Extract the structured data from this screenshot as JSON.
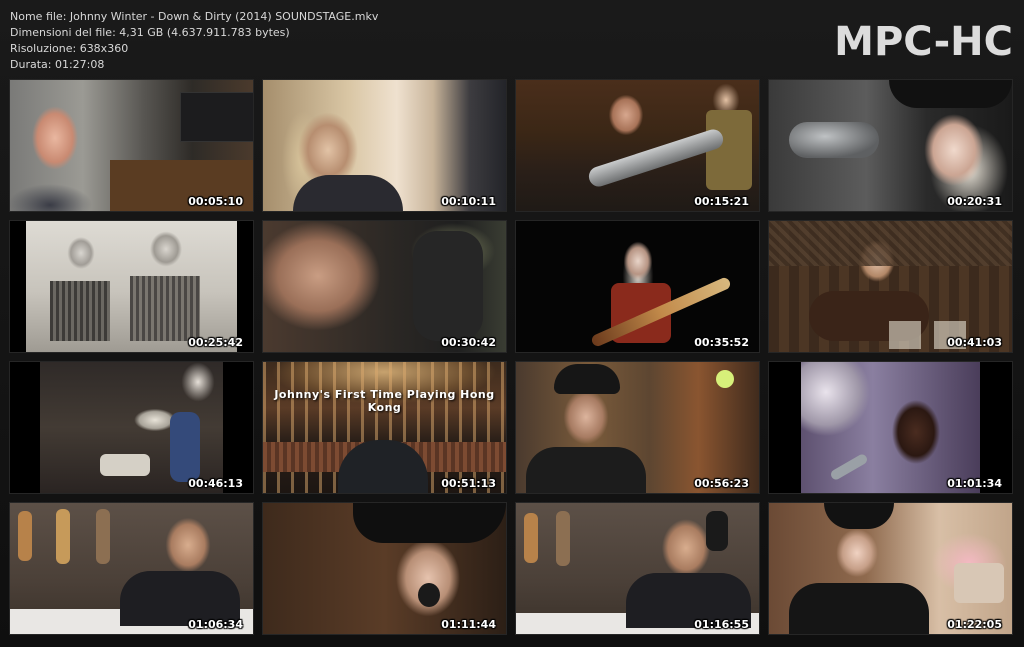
{
  "window": {
    "logo": "MPC-HC"
  },
  "file_info": {
    "name_line": "Nome file: Johnny Winter - Down & Dirty (2014) SOUNDSTAGE.mkv",
    "size_line": "Dimensioni del file: 4,31 GB (4.637.911.783 bytes)",
    "resolution_line": "Risoluzione: 638x360",
    "duration_line": "Durata: 01:27:08"
  },
  "thumbnails": [
    {
      "timestamp": "00:05:10",
      "scene": "older-man-profile-living-room"
    },
    {
      "timestamp": "00:10:11",
      "scene": "long-haired-man-in-van"
    },
    {
      "timestamp": "00:15:21",
      "scene": "studio-microphone-session"
    },
    {
      "timestamp": "00:20:31",
      "scene": "man-in-cowboy-hat-at-microphone"
    },
    {
      "timestamp": "00:25:42",
      "scene": "vintage-photo-two-boys-guitars"
    },
    {
      "timestamp": "00:30:42",
      "scene": "close-up-man-in-car"
    },
    {
      "timestamp": "00:35:52",
      "scene": "guitarist-on-dark-stage"
    },
    {
      "timestamp": "00:41:03",
      "scene": "man-drinking-in-bar"
    },
    {
      "timestamp": "00:46:13",
      "scene": "vintage-band-with-drums"
    },
    {
      "timestamp": "00:51:13",
      "scene": "concert-hall-audience",
      "caption": "Johnny's First Time Playing Hong Kong"
    },
    {
      "timestamp": "00:56:23",
      "scene": "man-in-cap-interview"
    },
    {
      "timestamp": "01:01:34",
      "scene": "singer-with-microphone"
    },
    {
      "timestamp": "01:06:34",
      "scene": "man-interview-guitar-wall"
    },
    {
      "timestamp": "01:11:44",
      "scene": "cowboy-hat-singer-close"
    },
    {
      "timestamp": "01:16:55",
      "scene": "man-interview-guitar-wall-2"
    },
    {
      "timestamp": "01:22:05",
      "scene": "man-in-cowboy-hat-bus"
    }
  ]
}
